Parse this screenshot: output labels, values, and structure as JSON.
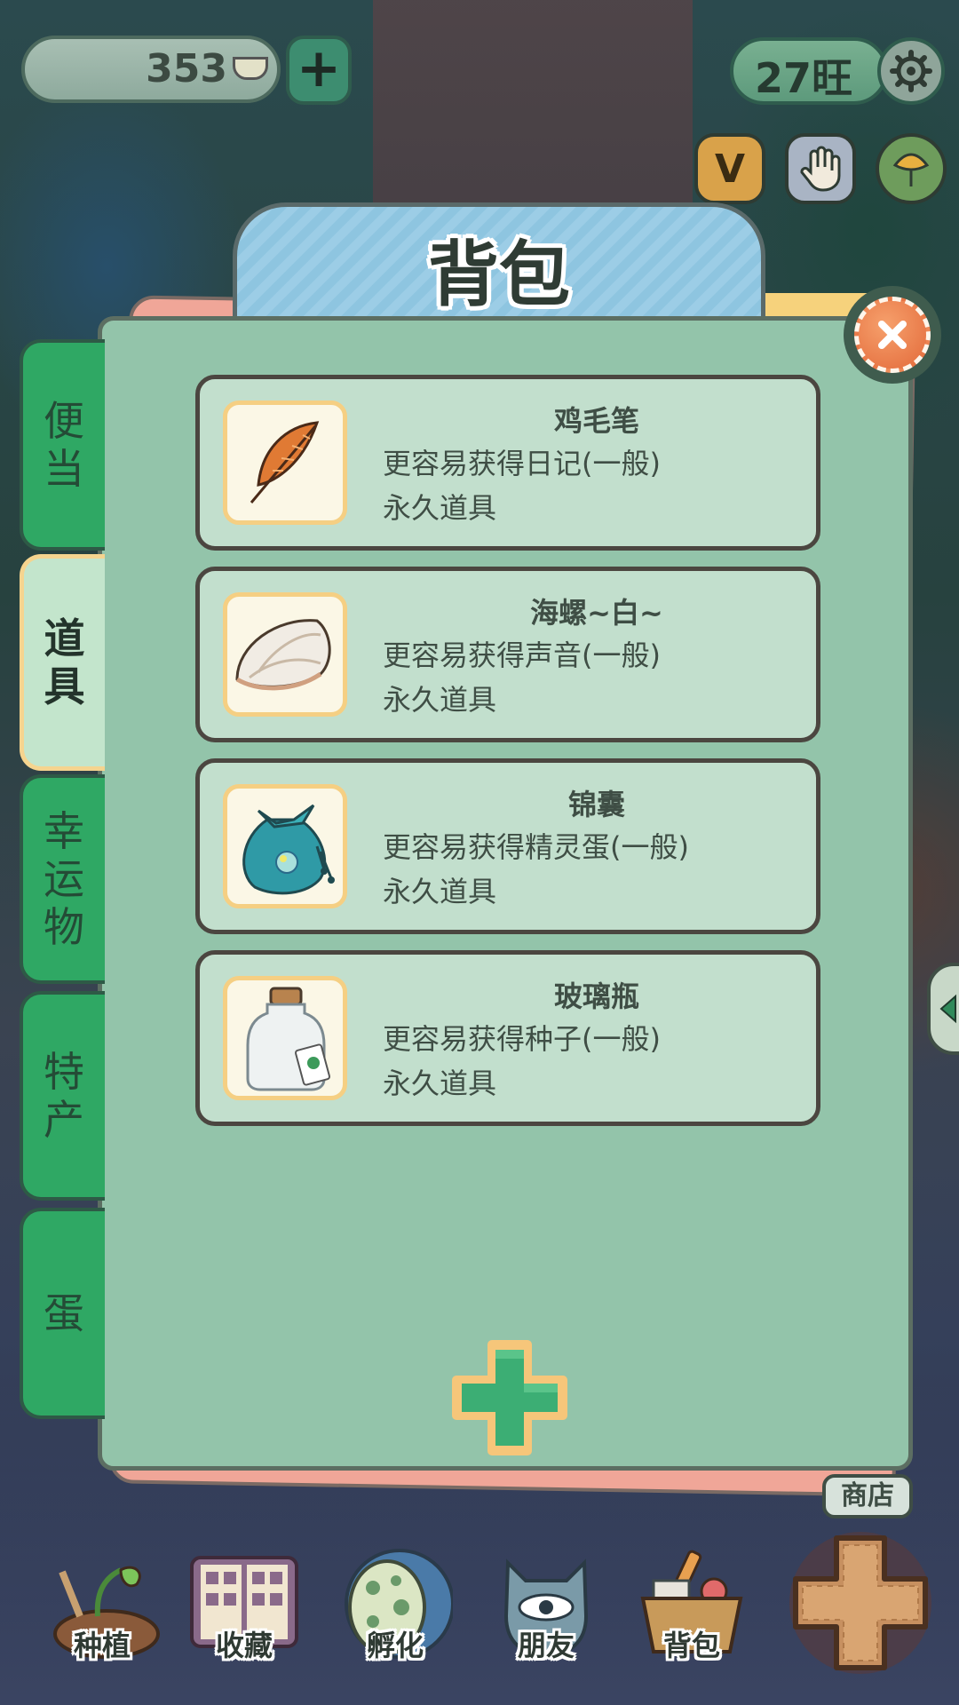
{
  "top_bar": {
    "coins": "353",
    "level": "27旺",
    "icons": [
      "coin-icon",
      "plus-icon",
      "gear-icon",
      "v-icon",
      "hand-icon",
      "leaf-icon"
    ]
  },
  "panel": {
    "title": "背包",
    "tabs": [
      {
        "label": "便当",
        "active": false
      },
      {
        "label": "道具",
        "active": true
      },
      {
        "label": "幸运物",
        "active": false
      },
      {
        "label": "特产",
        "active": false
      },
      {
        "label": "蛋",
        "active": false
      }
    ],
    "items": [
      {
        "name": "鸡毛笔",
        "desc": "更容易获得日记(一般)",
        "type": "永久道具",
        "icon": "feather-icon"
      },
      {
        "name": "海螺~白~",
        "desc": "更容易获得声音(一般)",
        "type": "永久道具",
        "icon": "conch-icon"
      },
      {
        "name": "锦囊",
        "desc": "更容易获得精灵蛋(一般)",
        "type": "永久道具",
        "icon": "pouch-icon"
      },
      {
        "name": "玻璃瓶",
        "desc": "更容易获得种子(一般)",
        "type": "永久道具",
        "icon": "glass-bottle-icon"
      }
    ]
  },
  "bottom_nav": {
    "shop_label": "商店",
    "items": [
      {
        "label": "种植",
        "icon": "sprout-icon"
      },
      {
        "label": "收藏",
        "icon": "book-icon"
      },
      {
        "label": "孵化",
        "icon": "egg-icon"
      },
      {
        "label": "朋友",
        "icon": "cat-icon"
      },
      {
        "label": "背包",
        "icon": "basket-icon"
      }
    ]
  },
  "colors": {
    "panel_bg": "#93c4aa",
    "card_bg": "#c2dfcd",
    "tab_green": "#2fa864",
    "accent_orange": "#e36a3a"
  }
}
